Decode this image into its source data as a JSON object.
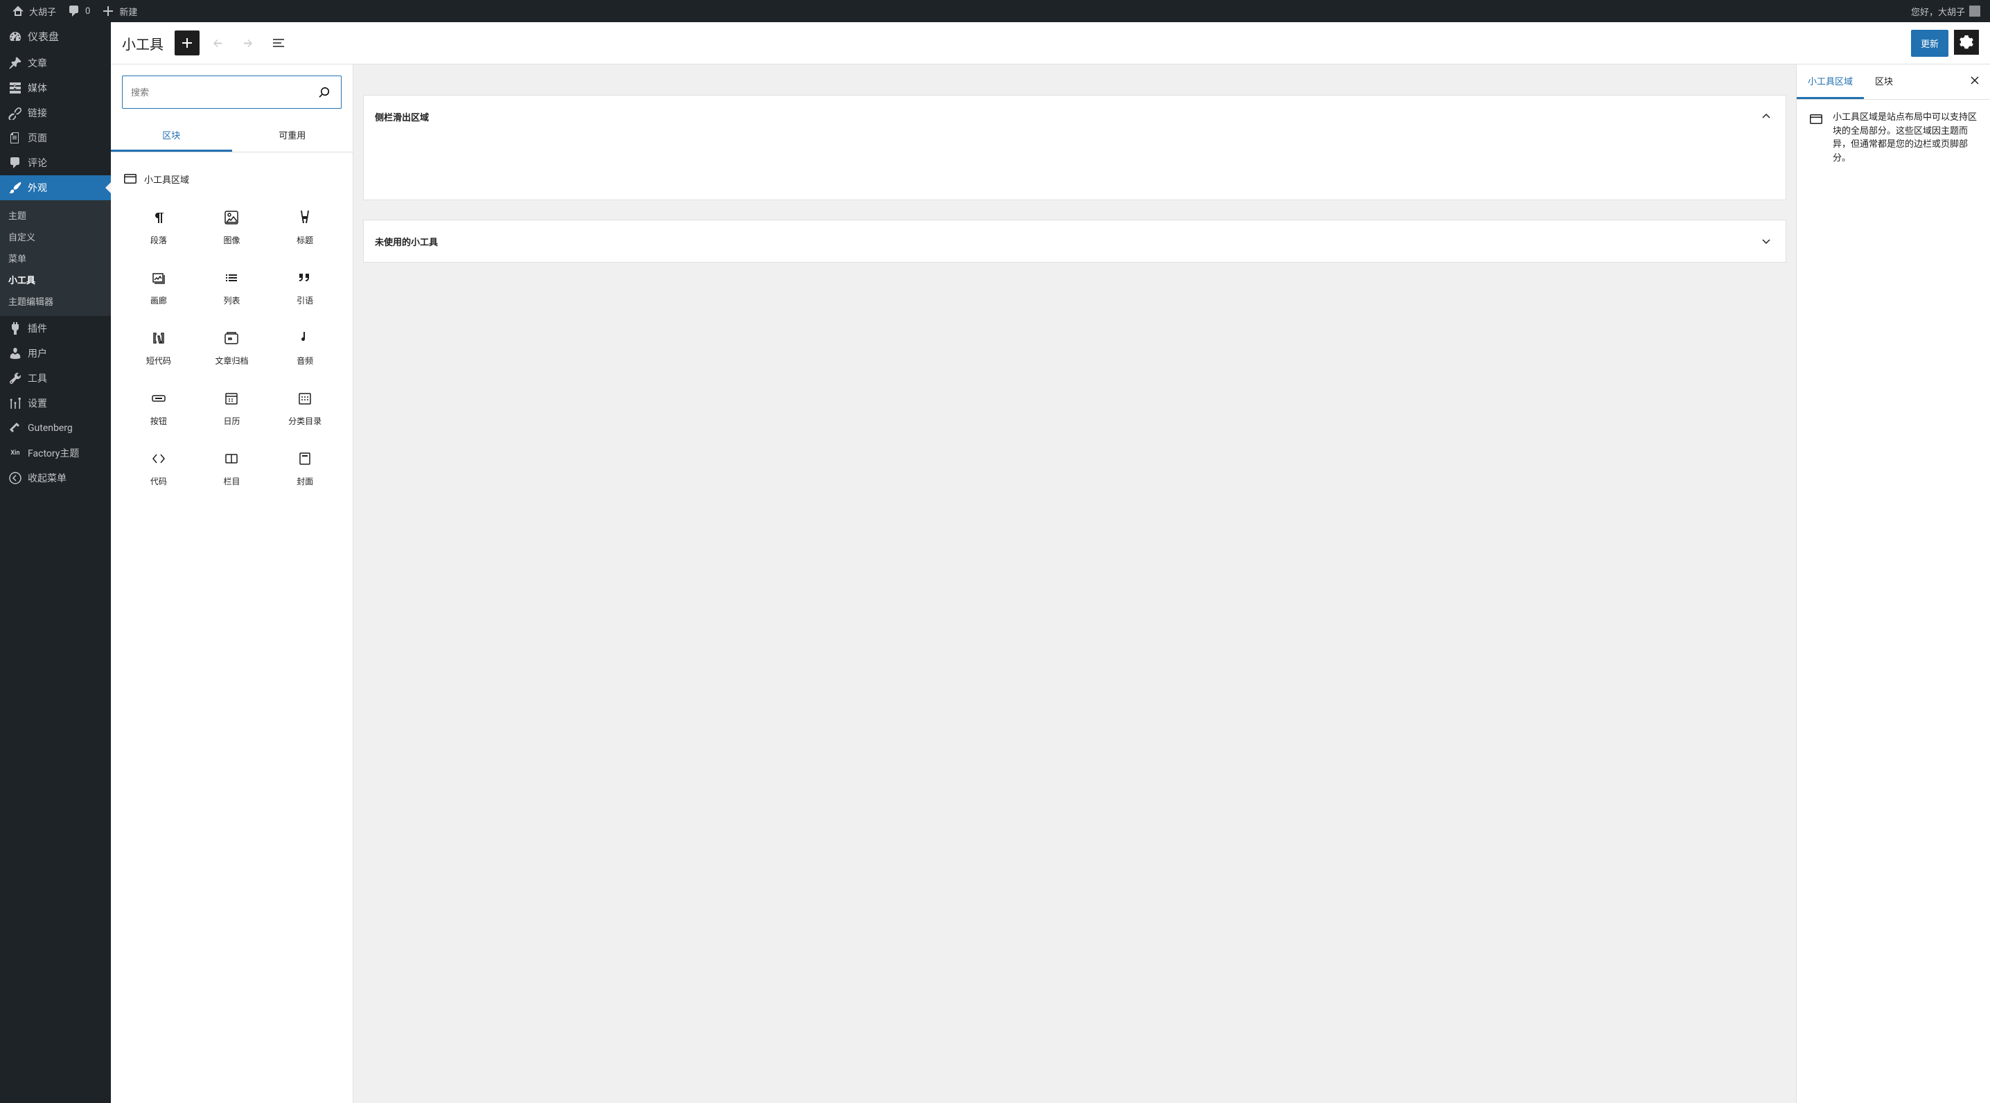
{
  "adminBar": {
    "siteName": "大胡子",
    "commentsCount": "0",
    "newLabel": "新建",
    "greeting": "您好，大胡子"
  },
  "sidebar": {
    "dashboard": "仪表盘",
    "posts": "文章",
    "media": "媒体",
    "links": "链接",
    "pages": "页面",
    "comments": "评论",
    "appearance": "外观",
    "appearanceSub": {
      "themes": "主题",
      "customize": "自定义",
      "menus": "菜单",
      "widgets": "小工具",
      "themeEditor": "主题编辑器"
    },
    "plugins": "插件",
    "users": "用户",
    "tools": "工具",
    "settings": "设置",
    "gutenberg": "Gutenberg",
    "factory": "Factory主题",
    "collapse": "收起菜单"
  },
  "toolbar": {
    "title": "小工具",
    "update": "更新"
  },
  "inserter": {
    "searchPlaceholder": "搜索",
    "tabBlocks": "区块",
    "tabReusable": "可重用",
    "categoryWidgetArea": "小工具区域",
    "blocks": {
      "paragraph": "段落",
      "image": "图像",
      "heading": "标题",
      "gallery": "画廊",
      "list": "列表",
      "quote": "引语",
      "shortcode": "短代码",
      "archives": "文章归档",
      "audio": "音频",
      "buttons": "按钮",
      "calendar": "日历",
      "categories": "分类目录",
      "code": "代码",
      "columns": "栏目",
      "cover": "封面"
    }
  },
  "canvas": {
    "area1": "侧栏滑出区域",
    "area2": "未使用的小工具"
  },
  "settings": {
    "tabWidgetArea": "小工具区域",
    "tabBlock": "区块",
    "description": "小工具区域是站点布局中可以支持区块的全局部分。这些区域因主题而异，但通常都是您的边栏或页脚部分。"
  }
}
